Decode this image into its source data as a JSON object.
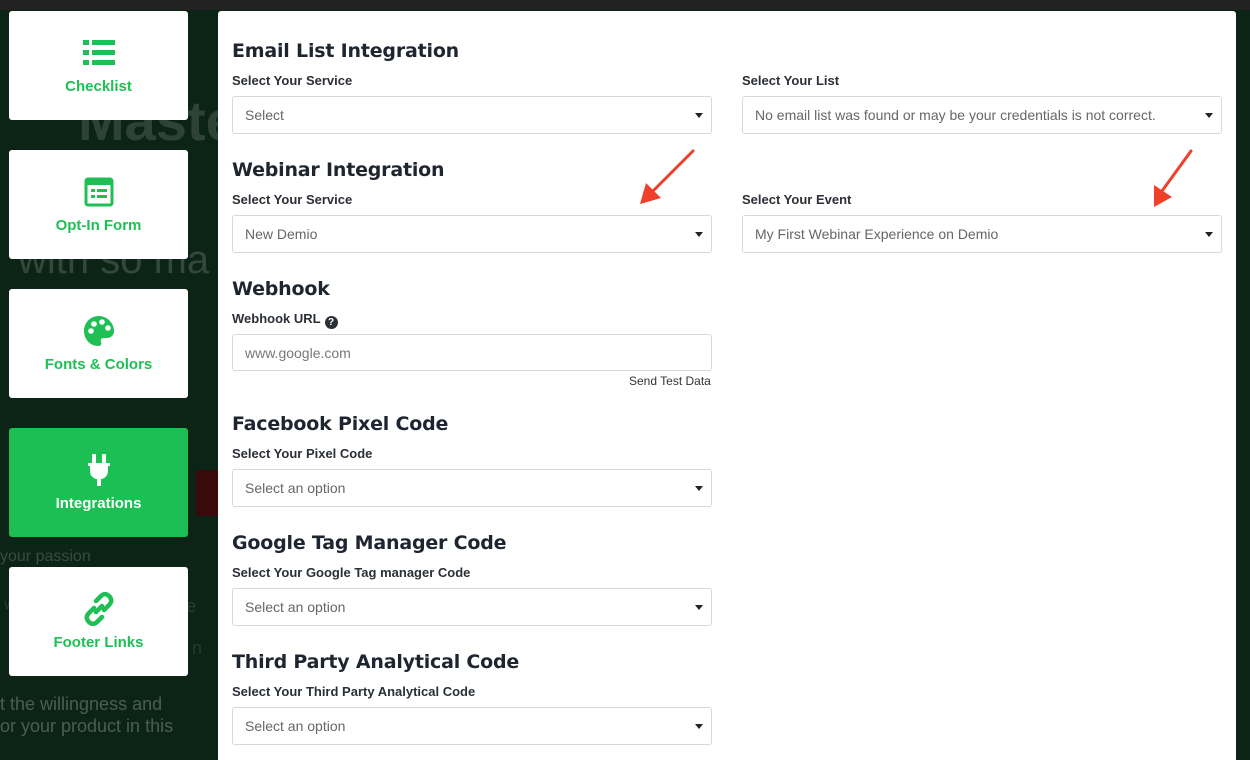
{
  "background": {
    "headline": "Maste",
    "subline": "with so ma",
    "passion": "your passion",
    "line1": "t the willingness and",
    "line2": "or your product in this",
    "faint_a": "w",
    "faint_b": "n",
    "faint_c": "e"
  },
  "sidebar": {
    "items": [
      {
        "label": "Checklist",
        "icon": "list-icon"
      },
      {
        "label": "Opt-In Form",
        "icon": "form-icon"
      },
      {
        "label": "Fonts & Colors",
        "icon": "palette-icon"
      },
      {
        "label": "Integrations",
        "icon": "plug-icon",
        "active": true
      },
      {
        "label": "Footer Links",
        "icon": "link-icon"
      }
    ]
  },
  "email_list": {
    "title": "Email List Integration",
    "service_label": "Select Your Service",
    "service_value": "Select",
    "list_label": "Select Your List",
    "list_value": "No email list was found or may be your credentials is not correct."
  },
  "webinar": {
    "title": "Webinar Integration",
    "service_label": "Select Your Service",
    "service_value": "New Demio",
    "event_label": "Select Your Event",
    "event_value": "My First Webinar Experience on Demio"
  },
  "webhook": {
    "title": "Webhook",
    "url_label": "Webhook URL",
    "url_placeholder": "www.google.com",
    "send_test": "Send Test Data"
  },
  "facebook": {
    "title": "Facebook Pixel Code",
    "label": "Select Your Pixel Code",
    "value": "Select an option"
  },
  "gtm": {
    "title": "Google Tag Manager Code",
    "label": "Select Your Google Tag manager Code",
    "value": "Select an option"
  },
  "third_party": {
    "title": "Third Party Analytical Code",
    "label": "Select Your Third Party Analytical Code",
    "value": "Select an option"
  },
  "colors": {
    "accent": "#1cbf53",
    "arrow": "#f0402a"
  }
}
